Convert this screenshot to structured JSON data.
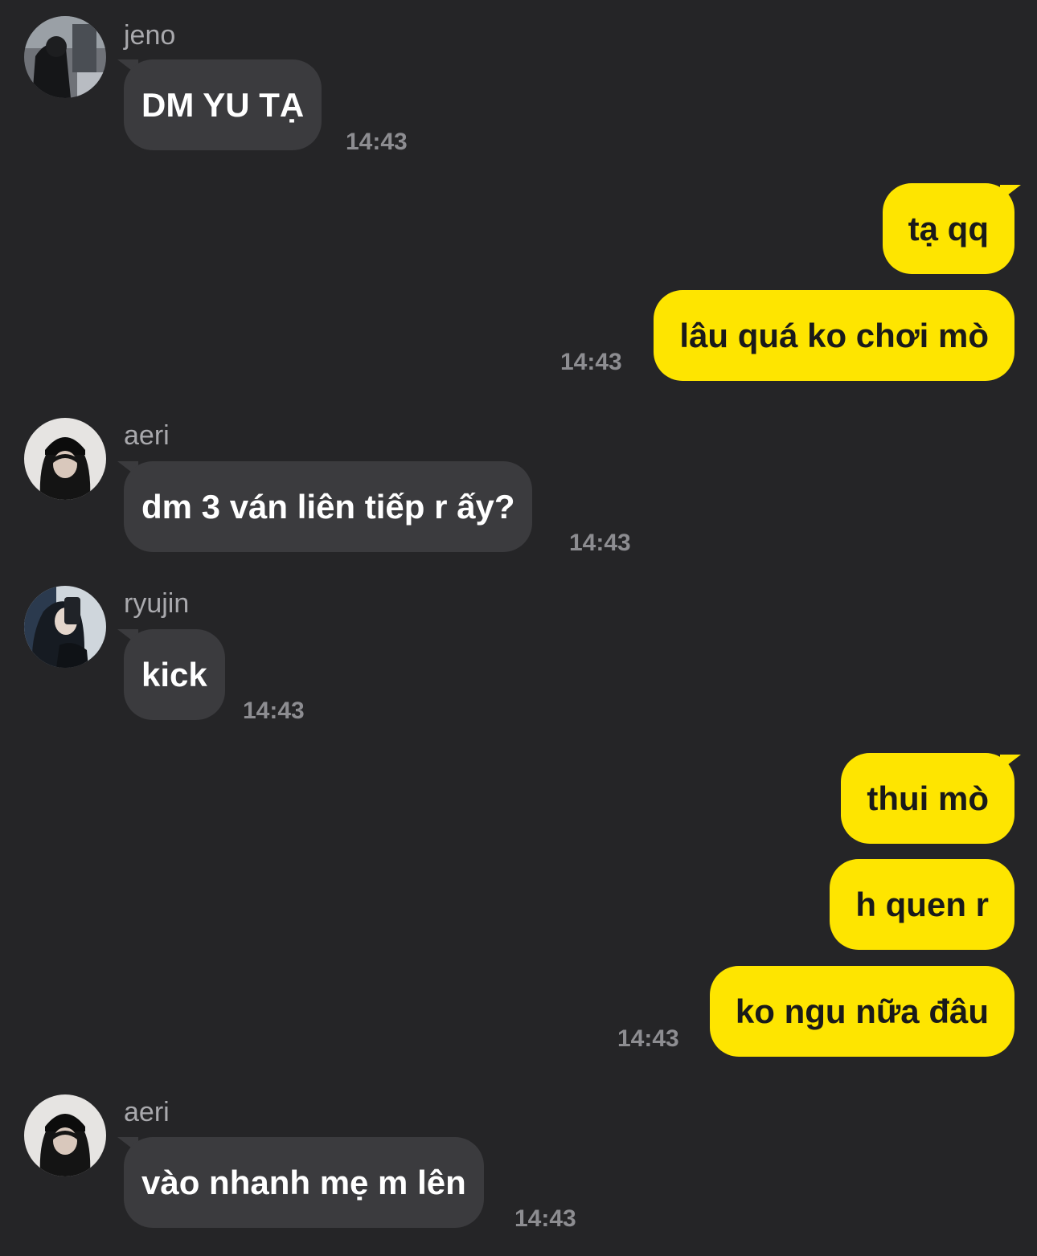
{
  "colors": {
    "background": "#252527",
    "incoming_bubble": "#3b3b3e",
    "outgoing_bubble": "#fee500",
    "timestamp": "#8d8d91",
    "sender_name": "#a9a9ad"
  },
  "messages": [
    {
      "sender": "jeno",
      "avatar": "jeno-avatar",
      "text": "DM YU TẠ",
      "time": "14:43"
    },
    {
      "sender": "me",
      "text": "tạ qq"
    },
    {
      "sender": "me",
      "text": "lâu quá ko chơi mò",
      "time": "14:43"
    },
    {
      "sender": "aeri",
      "avatar": "aeri-avatar",
      "text": "dm 3 ván liên tiếp r ấy?",
      "time": "14:43"
    },
    {
      "sender": "ryujin",
      "avatar": "ryujin-avatar",
      "text": "kick",
      "time": "14:43"
    },
    {
      "sender": "me",
      "text": "thui mò"
    },
    {
      "sender": "me",
      "text": "h quen r"
    },
    {
      "sender": "me",
      "text": "ko ngu nữa đâu",
      "time": "14:43"
    },
    {
      "sender": "aeri",
      "avatar": "aeri-avatar",
      "text": "vào nhanh mẹ m lên",
      "time": "14:43"
    }
  ]
}
